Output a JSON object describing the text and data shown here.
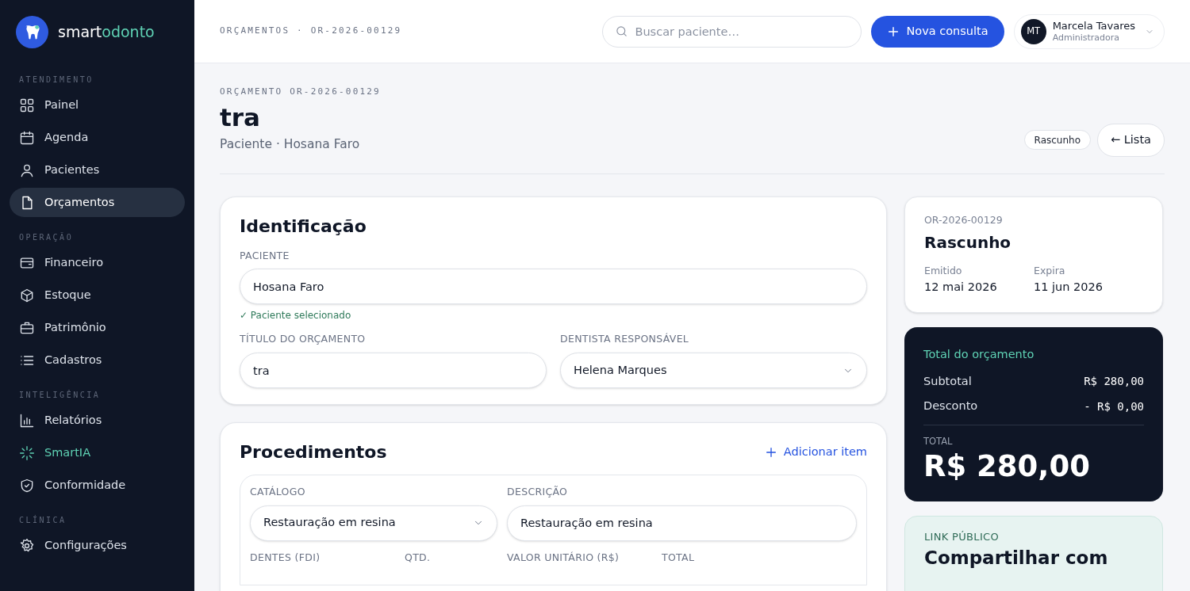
{
  "sidebar": {
    "brand": {
      "part_1": "smart",
      "part_2": "odonto"
    },
    "sections": [
      {
        "heading": "ATENDIMENTO",
        "items": [
          {
            "label": "Painel",
            "selected": false,
            "accent": false
          },
          {
            "label": "Agenda",
            "selected": false,
            "accent": false
          },
          {
            "label": "Pacientes",
            "selected": false,
            "accent": false
          },
          {
            "label": "Orçamentos",
            "selected": true,
            "accent": false
          }
        ]
      },
      {
        "heading": "OPERAÇÃO",
        "items": [
          {
            "label": "Financeiro",
            "selected": false,
            "accent": false
          },
          {
            "label": "Estoque",
            "selected": false,
            "accent": false
          },
          {
            "label": "Patrimônio",
            "selected": false,
            "accent": false
          },
          {
            "label": "Cadastros",
            "selected": false,
            "accent": false
          }
        ]
      },
      {
        "heading": "INTELIGÊNCIA",
        "items": [
          {
            "label": "Relatórios",
            "selected": false,
            "accent": false
          },
          {
            "label": "SmartIA",
            "selected": false,
            "accent": true
          },
          {
            "label": "Conformidade",
            "selected": false,
            "accent": false
          }
        ]
      },
      {
        "heading": "CLÍNICA",
        "items": [
          {
            "label": "Configurações",
            "selected": false,
            "accent": false
          }
        ]
      }
    ]
  },
  "header": {
    "breadcrumb": "ORÇAMENTOS · OR-2026-00129",
    "search": {
      "placeholder": "Buscar paciente…"
    },
    "new_button": "Nova consulta",
    "user": {
      "initials": "MT",
      "name": "Marcela Tavares",
      "role": "Administradora"
    }
  },
  "page": {
    "eyebrow": "ORÇAMENTO OR-2026-00129",
    "title": "tra",
    "subtitle": "Paciente · Hosana Faro",
    "status_badge": "Rascunho",
    "back_button": "← Lista"
  },
  "identification": {
    "title": "Identificação",
    "patient": {
      "label": "PACIENTE",
      "value": "Hosana Faro",
      "hint": "✓ Paciente selecionado"
    },
    "fields": [
      {
        "label": "TÍTULO DO ORÇAMENTO",
        "value": "tra",
        "kind": "text"
      },
      {
        "label": "DENTISTA RESPONSÁVEL",
        "value": "Helena Marques",
        "kind": "select"
      }
    ]
  },
  "procedures": {
    "title": "Procedimentos",
    "add_button": "Adicionar item",
    "item": {
      "fields": [
        {
          "label": "CATÁLOGO",
          "value": "Restauração em resina",
          "kind": "select"
        },
        {
          "label": "DESCRIÇÃO",
          "value": "Restauração em resina",
          "kind": "text"
        }
      ],
      "columns": [
        "DENTES (FDI)",
        "QTD.",
        "VALOR UNITÁRIO (R$)",
        "TOTAL"
      ]
    }
  },
  "summary": {
    "code": "OR-2026-00129",
    "status": "Rascunho",
    "dates": [
      {
        "label": "Emitido",
        "value": "12 mai 2026"
      },
      {
        "label": "Expira",
        "value": "11 jun 2026"
      }
    ]
  },
  "totals": {
    "title": "Total do orçamento",
    "rows": [
      {
        "label": "Subtotal",
        "value": "R$ 280,00"
      },
      {
        "label": "Desconto",
        "value": "- R$ 0,00"
      }
    ],
    "total_label": "TOTAL",
    "total_value": "R$ 280,00"
  },
  "public_link": {
    "label": "LINK PÚBLICO",
    "title": "Compartilhar com"
  }
}
